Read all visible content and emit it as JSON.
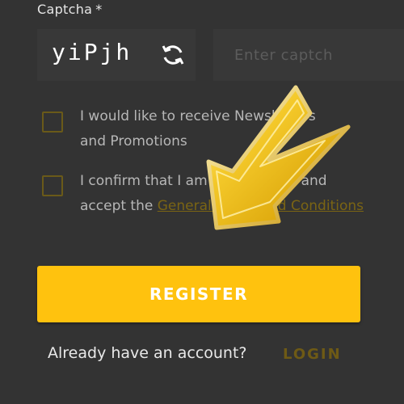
{
  "captcha": {
    "label": "Captcha",
    "required_marker": "*",
    "code": "yiPjh",
    "refresh_icon": "refresh-icon",
    "input_placeholder": "Enter captch"
  },
  "checkboxes": {
    "newsletter": {
      "label_line1": "I would like to receive Newsletters",
      "label_line2": "and Promotions",
      "checked": false
    },
    "terms": {
      "label_line1": "I confirm that I am 18 years old and",
      "label_prefix": "accept the",
      "link_text": "General Terms and Conditions",
      "checked": false
    }
  },
  "register_button": {
    "label": "REGISTER"
  },
  "footer": {
    "account_prompt": "Already have an account?",
    "login_label": "LOGIN"
  },
  "overlay": {
    "icon": "arrow-icon"
  },
  "colors": {
    "background": "#333333",
    "accent": "#ffc20e",
    "checkbox_border": "#6a5a19",
    "link": "#7a6414",
    "arrow_gold": "#f2c51d"
  }
}
